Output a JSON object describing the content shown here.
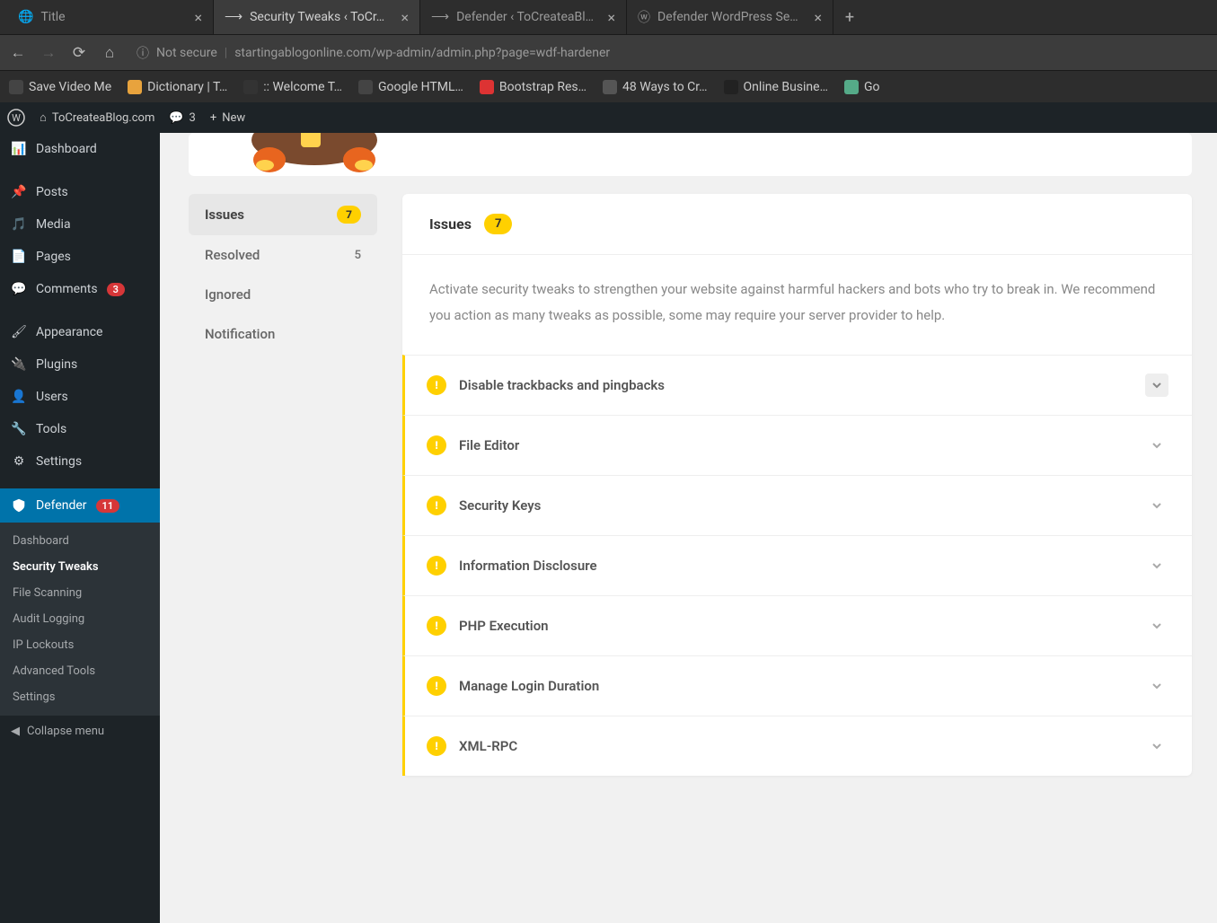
{
  "browser": {
    "tabs": [
      {
        "title": "Title"
      },
      {
        "title": "Security Tweaks ‹ ToCr…"
      },
      {
        "title": "Defender ‹ ToCreateaBl…"
      },
      {
        "title": "Defender WordPress Se…"
      }
    ],
    "url_insecure": "Not secure",
    "url": "startingablogonline.com/wp-admin/admin.php?page=wdf-hardener",
    "bookmarks": [
      {
        "label": "Save Video Me"
      },
      {
        "label": "Dictionary | T…"
      },
      {
        "label": ":: Welcome T…"
      },
      {
        "label": "Google HTML…"
      },
      {
        "label": "Bootstrap Res…"
      },
      {
        "label": "48 Ways to Cr…"
      },
      {
        "label": "Online Busine…"
      },
      {
        "label": "Go"
      }
    ]
  },
  "wpbar": {
    "site": "ToCreateaBlog.com",
    "comments": "3",
    "new": "New"
  },
  "sidebar": {
    "items": [
      {
        "label": "Dashboard"
      },
      {
        "label": "Posts"
      },
      {
        "label": "Media"
      },
      {
        "label": "Pages"
      },
      {
        "label": "Comments",
        "badge": "3"
      },
      {
        "label": "Appearance"
      },
      {
        "label": "Plugins"
      },
      {
        "label": "Users"
      },
      {
        "label": "Tools"
      },
      {
        "label": "Settings"
      },
      {
        "label": "Defender",
        "badge": "11"
      }
    ],
    "sub": [
      {
        "label": "Dashboard"
      },
      {
        "label": "Security Tweaks"
      },
      {
        "label": "File Scanning"
      },
      {
        "label": "Audit Logging"
      },
      {
        "label": "IP Lockouts"
      },
      {
        "label": "Advanced Tools"
      },
      {
        "label": "Settings"
      }
    ],
    "collapse": "Collapse menu"
  },
  "tabs": [
    {
      "label": "Issues",
      "count": "7"
    },
    {
      "label": "Resolved",
      "count": "5"
    },
    {
      "label": "Ignored"
    },
    {
      "label": "Notification"
    }
  ],
  "panel": {
    "heading": "Issues",
    "count": "7",
    "desc": "Activate security tweaks to strengthen your website against harmful hackers and bots who try to break in. We recommend you action as many tweaks as possible, some   may require your server provider to help."
  },
  "tweaks": [
    {
      "title": "Disable trackbacks and pingbacks"
    },
    {
      "title": "File Editor"
    },
    {
      "title": "Security Keys"
    },
    {
      "title": "Information Disclosure"
    },
    {
      "title": "PHP Execution"
    },
    {
      "title": "Manage Login Duration"
    },
    {
      "title": "XML-RPC"
    }
  ]
}
